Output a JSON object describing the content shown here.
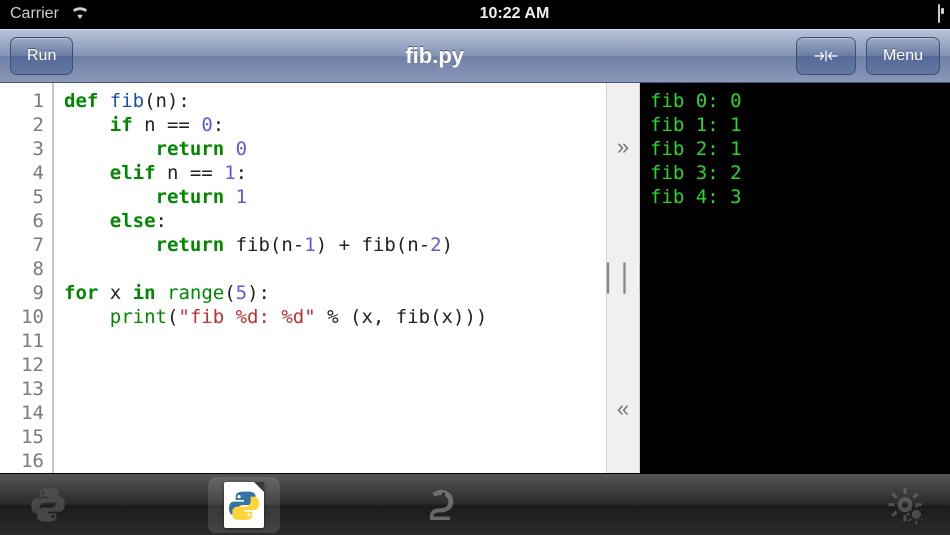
{
  "statusbar": {
    "carrier": "Carrier",
    "time": "10:22 AM"
  },
  "navbar": {
    "run_label": "Run",
    "title": "fib.py",
    "menu_label": "Menu"
  },
  "editor": {
    "line_count": 16,
    "lines": [
      {
        "n": 1,
        "tokens": [
          [
            "kw",
            "def "
          ],
          [
            "def-name",
            "fib"
          ],
          [
            "op",
            "(n):"
          ]
        ]
      },
      {
        "n": 2,
        "tokens": [
          [
            "pad",
            "    "
          ],
          [
            "kw",
            "if"
          ],
          [
            "id",
            " n "
          ],
          [
            "op",
            "=="
          ],
          [
            "id",
            " "
          ],
          [
            "num",
            "0"
          ],
          [
            "op",
            ":"
          ]
        ]
      },
      {
        "n": 3,
        "tokens": [
          [
            "pad",
            "        "
          ],
          [
            "kw",
            "return"
          ],
          [
            "id",
            " "
          ],
          [
            "num",
            "0"
          ]
        ]
      },
      {
        "n": 4,
        "tokens": [
          [
            "pad",
            "    "
          ],
          [
            "kw",
            "elif"
          ],
          [
            "id",
            " n "
          ],
          [
            "op",
            "=="
          ],
          [
            "id",
            " "
          ],
          [
            "num",
            "1"
          ],
          [
            "op",
            ":"
          ]
        ]
      },
      {
        "n": 5,
        "tokens": [
          [
            "pad",
            "        "
          ],
          [
            "kw",
            "return"
          ],
          [
            "id",
            " "
          ],
          [
            "num",
            "1"
          ]
        ]
      },
      {
        "n": 6,
        "tokens": [
          [
            "pad",
            "    "
          ],
          [
            "kw",
            "else"
          ],
          [
            "op",
            ":"
          ]
        ]
      },
      {
        "n": 7,
        "tokens": [
          [
            "pad",
            "        "
          ],
          [
            "kw",
            "return"
          ],
          [
            "id",
            " fib(n"
          ],
          [
            "op",
            "-"
          ],
          [
            "num",
            "1"
          ],
          [
            "id",
            ") "
          ],
          [
            "op",
            "+"
          ],
          [
            "id",
            " fib(n"
          ],
          [
            "op",
            "-"
          ],
          [
            "num",
            "2"
          ],
          [
            "id",
            ")"
          ]
        ]
      },
      {
        "n": 8,
        "tokens": []
      },
      {
        "n": 9,
        "tokens": [
          [
            "kw",
            "for"
          ],
          [
            "id",
            " x "
          ],
          [
            "kw",
            "in"
          ],
          [
            "id",
            " "
          ],
          [
            "bi",
            "range"
          ],
          [
            "op",
            "("
          ],
          [
            "num",
            "5"
          ],
          [
            "op",
            "):"
          ]
        ]
      },
      {
        "n": 10,
        "tokens": [
          [
            "pad",
            "    "
          ],
          [
            "bi",
            "print"
          ],
          [
            "op",
            "("
          ],
          [
            "str",
            "\"fib %d: %d\""
          ],
          [
            "id",
            " "
          ],
          [
            "op",
            "%"
          ],
          [
            "id",
            " (x, fib(x)))"
          ]
        ]
      },
      {
        "n": 11,
        "tokens": []
      },
      {
        "n": 12,
        "tokens": []
      },
      {
        "n": 13,
        "tokens": []
      },
      {
        "n": 14,
        "tokens": []
      },
      {
        "n": 15,
        "tokens": []
      },
      {
        "n": 16,
        "tokens": []
      }
    ]
  },
  "console": {
    "output": [
      "fib 0: 0",
      "fib 1: 1",
      "fib 2: 1",
      "fib 3: 2",
      "fib 4: 3"
    ]
  },
  "splitter": {
    "expand_right": "»",
    "grip": "⎪⎪⎪",
    "expand_left": "«"
  }
}
